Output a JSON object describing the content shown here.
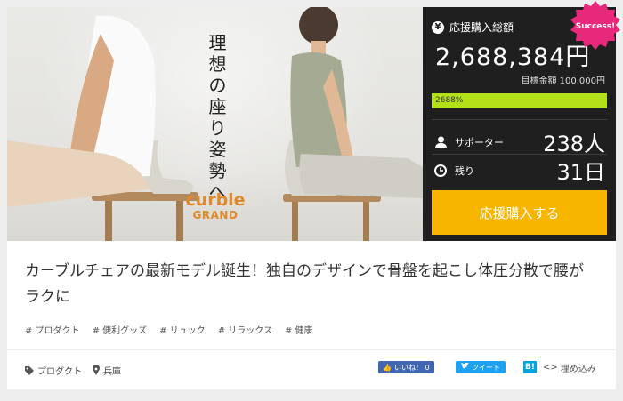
{
  "hero": {
    "tagline": "理想の座り姿勢へ",
    "logo_line1": "curble",
    "logo_line2": "GRAND"
  },
  "panel": {
    "total_label": "応援購入総額",
    "total_amount": "2,688,384円",
    "goal": "目標金額 100,000円",
    "progress_text": "2688%",
    "progress_fraction": 1.0,
    "supporters_label": "サポーター",
    "supporters_value": "238人",
    "remaining_label": "残り",
    "remaining_value": "31日",
    "cta_label": "応援購入する",
    "badge_text": "Success!"
  },
  "project": {
    "title": "カーブルチェアの最新モデル誕生！独自のデザインで骨盤を起こし体圧分散で腰がラクに",
    "tags": [
      "# プロダクト",
      "# 便利グッズ",
      "# リュック",
      "# リラックス",
      "# 健康"
    ],
    "category": "プロダクト",
    "location": "兵庫"
  },
  "share": {
    "facebook_label": "いいね！ 0",
    "tweet_label": "ツイート",
    "hatena_label": "B!",
    "embed_label": "埋め込み"
  },
  "colors": {
    "panel_bg": "#1f1f1f",
    "cta": "#f8b500",
    "progress": "#b4e01a",
    "badge": "#e8287a",
    "logo": "#e0892a"
  },
  "icons": [
    "yen-icon",
    "user-icon",
    "clock-icon",
    "tag-icon",
    "pin-icon",
    "facebook-like-icon",
    "twitter-icon",
    "hatena-icon",
    "embed-code-icon"
  ]
}
